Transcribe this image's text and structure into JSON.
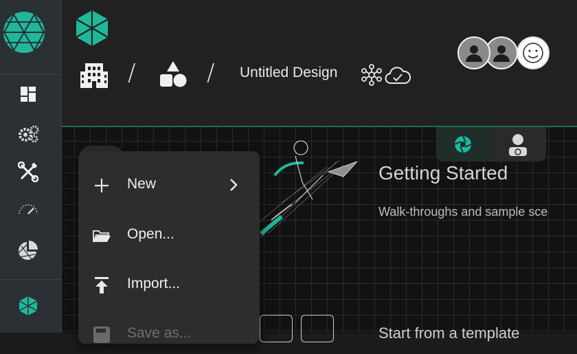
{
  "header": {
    "design_title": "Untitled Design",
    "breadcrumb_separator": "/"
  },
  "rail": {
    "items": [
      {
        "name": "dashboard",
        "icon": "dashboard-icon"
      },
      {
        "name": "settings",
        "icon": "gears-icon"
      },
      {
        "name": "tools",
        "icon": "wrench-screwdriver-icon"
      },
      {
        "name": "speed",
        "icon": "gauge-icon"
      },
      {
        "name": "analytics",
        "icon": "pie-chart-icon"
      },
      {
        "name": "app",
        "icon": "hexagon-logo-icon"
      }
    ]
  },
  "menu": {
    "items": [
      {
        "label": "New",
        "icon": "plus-icon",
        "submenu": true
      },
      {
        "label": "Open...",
        "icon": "folder-icon"
      },
      {
        "label": "Import...",
        "icon": "import-icon"
      },
      {
        "label": "Save as...",
        "icon": "save-icon",
        "disabled": true
      }
    ]
  },
  "getting_started": {
    "title": "Getting Started",
    "subtitle": "Walk-throughs and sample sce",
    "bottom_text": "Start from a template"
  },
  "colors": {
    "accent": "#1fb89a",
    "rail_bg": "#2b3035",
    "header_bg": "#212121",
    "menu_bg": "#2d2d2d"
  }
}
